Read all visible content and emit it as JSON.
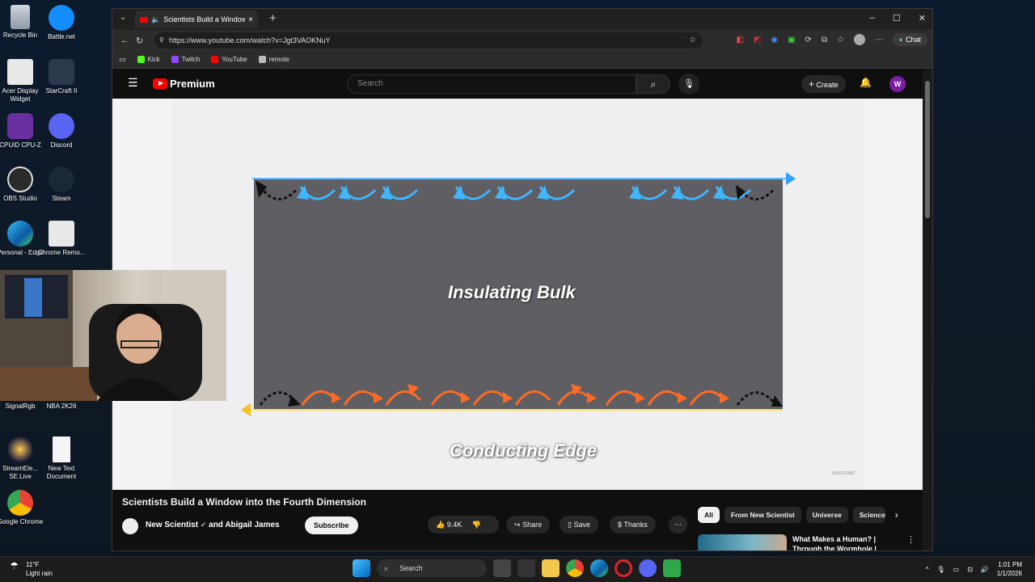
{
  "desktop": {
    "icons": [
      {
        "label": "Recycle Bin"
      },
      {
        "label": "Battle.net"
      },
      {
        "label": "Acer Display Widget"
      },
      {
        "label": "StarCraft II"
      },
      {
        "label": "CPUID CPU-Z"
      },
      {
        "label": "Discord"
      },
      {
        "label": "OBS Studio"
      },
      {
        "label": "Steam"
      },
      {
        "label": "Personal - Edge"
      },
      {
        "label": "Chrome Remo..."
      },
      {
        "label": "SignalRgb"
      },
      {
        "label": "NBA 2K26"
      },
      {
        "label": "StreamEle... SE.Live"
      },
      {
        "label": "New Text Document"
      },
      {
        "label": "Google Chrome"
      }
    ]
  },
  "browser": {
    "tab_title": "Scientists Build a Window into the Fourth Dimension",
    "url": "https://www.youtube.com/watch?v=Jgt3VAOKNuY",
    "chat_label": "Chat",
    "bookmarks": [
      {
        "label": "Kick",
        "color": "#53fc18"
      },
      {
        "label": "Twitch",
        "color": "#9146ff"
      },
      {
        "label": "YouTube",
        "color": "#ff0000"
      },
      {
        "label": "remote",
        "color": "#bbbbbb"
      }
    ]
  },
  "youtube": {
    "logo_text": "Premium",
    "search_placeholder": "Search",
    "create_label": "Create",
    "avatar_letter": "W",
    "video": {
      "label_top": "Insulating Bulk",
      "label_bottom": "Conducting Edge",
      "watermark": "SUBSCRIBE"
    },
    "title": "Scientists Build a Window into the Fourth Dimension",
    "channel": "New Scientist",
    "channel_and": "and Abigail James",
    "subscribe_label": "Subscribe",
    "likes": "9.4K",
    "share_label": "Share",
    "save_label": "Save",
    "thanks_label": "Thanks",
    "chips": [
      "All",
      "From New Scientist",
      "Universe",
      "Science"
    ],
    "recommendation_title": "What Makes a Human? | Through the Wormhole |"
  },
  "taskbar": {
    "temp": "11°F",
    "weather": "Light rain",
    "search_label": "Search",
    "time": "1:01 PM",
    "date": "1/1/2026"
  }
}
